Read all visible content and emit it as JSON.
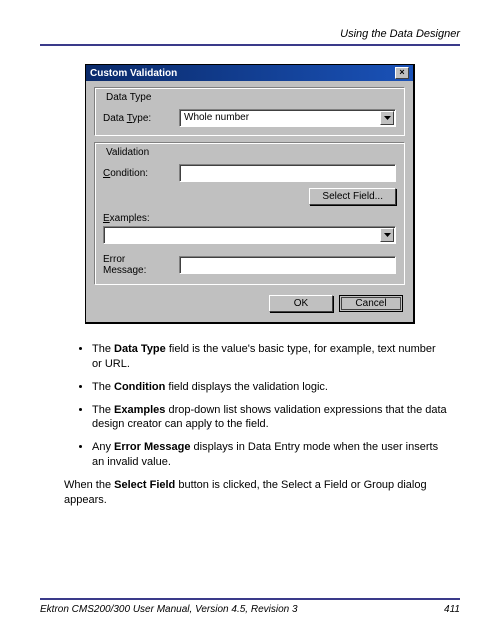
{
  "header": {
    "breadcrumb": "Using the Data Designer"
  },
  "dialog": {
    "title": "Custom Validation",
    "group_data_type": {
      "title": "Data Type",
      "label": "Data Type:",
      "value": "Whole number"
    },
    "group_validation": {
      "title": "Validation",
      "condition_label": "Condition:",
      "select_field_btn": "Select Field...",
      "examples_label": "Examples:",
      "error_message_label": "Error Message:"
    },
    "ok_btn": "OK",
    "cancel_btn": "Cancel"
  },
  "bullets": [
    {
      "bold": "Data Type",
      "text_before": "The ",
      "text_after": " field is the value's basic type, for example, text number or URL."
    },
    {
      "bold": "Condition",
      "text_before": "The ",
      "text_after": " field displays the validation logic."
    },
    {
      "bold": "Examples",
      "text_before": "The ",
      "text_after": " drop-down list shows validation expressions that the data design creator can apply to the field."
    },
    {
      "bold": "Error Message",
      "text_before": "Any ",
      "text_after": " displays in Data Entry mode when the user inserts an invalid value."
    }
  ],
  "paragraph": {
    "pre": "When the ",
    "bold": "Select Field",
    "post": " button is clicked, the Select a Field or Group dialog appears."
  },
  "footer": {
    "left": "Ektron CMS200/300 User Manual, Version 4.5, Revision 3",
    "right": "411"
  }
}
